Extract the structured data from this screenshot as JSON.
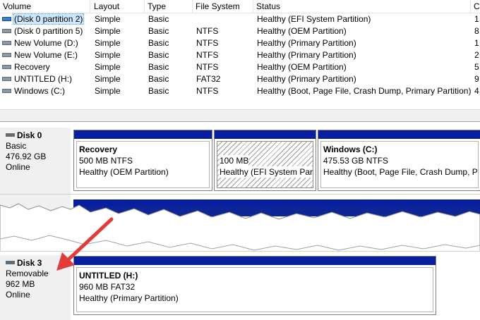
{
  "columns": {
    "volume": "Volume",
    "layout": "Layout",
    "type": "Type",
    "file_system": "File System",
    "status": "Status",
    "capacity": "C"
  },
  "volumes": [
    {
      "name": "(Disk 0 partition 2)",
      "layout": "Simple",
      "type": "Basic",
      "fs": "",
      "status": "Healthy (EFI System Partition)",
      "cap": "1",
      "icon": "disk-blue-icon",
      "selected": true
    },
    {
      "name": "(Disk 0 partition 5)",
      "layout": "Simple",
      "type": "Basic",
      "fs": "NTFS",
      "status": "Healthy (OEM Partition)",
      "cap": "8",
      "icon": "disk-icon"
    },
    {
      "name": "New Volume (D:)",
      "layout": "Simple",
      "type": "Basic",
      "fs": "NTFS",
      "status": "Healthy (Primary Partition)",
      "cap": "1",
      "icon": "disk-icon"
    },
    {
      "name": "New Volume (E:)",
      "layout": "Simple",
      "type": "Basic",
      "fs": "NTFS",
      "status": "Healthy (Primary Partition)",
      "cap": "2",
      "icon": "disk-icon"
    },
    {
      "name": "Recovery",
      "layout": "Simple",
      "type": "Basic",
      "fs": "NTFS",
      "status": "Healthy (OEM Partition)",
      "cap": "5",
      "icon": "disk-icon"
    },
    {
      "name": "UNTITLED (H:)",
      "layout": "Simple",
      "type": "Basic",
      "fs": "FAT32",
      "status": "Healthy (Primary Partition)",
      "cap": "9",
      "icon": "disk-icon"
    },
    {
      "name": "Windows (C:)",
      "layout": "Simple",
      "type": "Basic",
      "fs": "NTFS",
      "status": "Healthy (Boot, Page File, Crash Dump, Primary Partition)",
      "cap": "4",
      "icon": "disk-icon"
    }
  ],
  "disks": [
    {
      "name": "Disk 0",
      "kind": "Basic",
      "size": "476.92 GB",
      "state": "Online",
      "partitions": [
        {
          "title": "Recovery",
          "line1": "500 MB NTFS",
          "line2": "Healthy (OEM Partition)"
        },
        {
          "title": "",
          "line1": "100 MB",
          "line2": "Healthy (EFI System Parti"
        },
        {
          "title": "Windows  (C:)",
          "line1": "475.53 GB NTFS",
          "line2": "Healthy (Boot, Page File, Crash Dump, Prin"
        }
      ]
    },
    {
      "name": "Disk 3",
      "kind": "Removable",
      "size": "962 MB",
      "state": "Online",
      "partitions": [
        {
          "title": "UNTITLED  (H:)",
          "line1": "960 MB FAT32",
          "line2": "Healthy (Primary Partition)"
        }
      ]
    }
  ],
  "colors": {
    "partition_bar": "#0a1fa0",
    "selection": "#cce8ff",
    "arrow": "#e23b3b"
  }
}
